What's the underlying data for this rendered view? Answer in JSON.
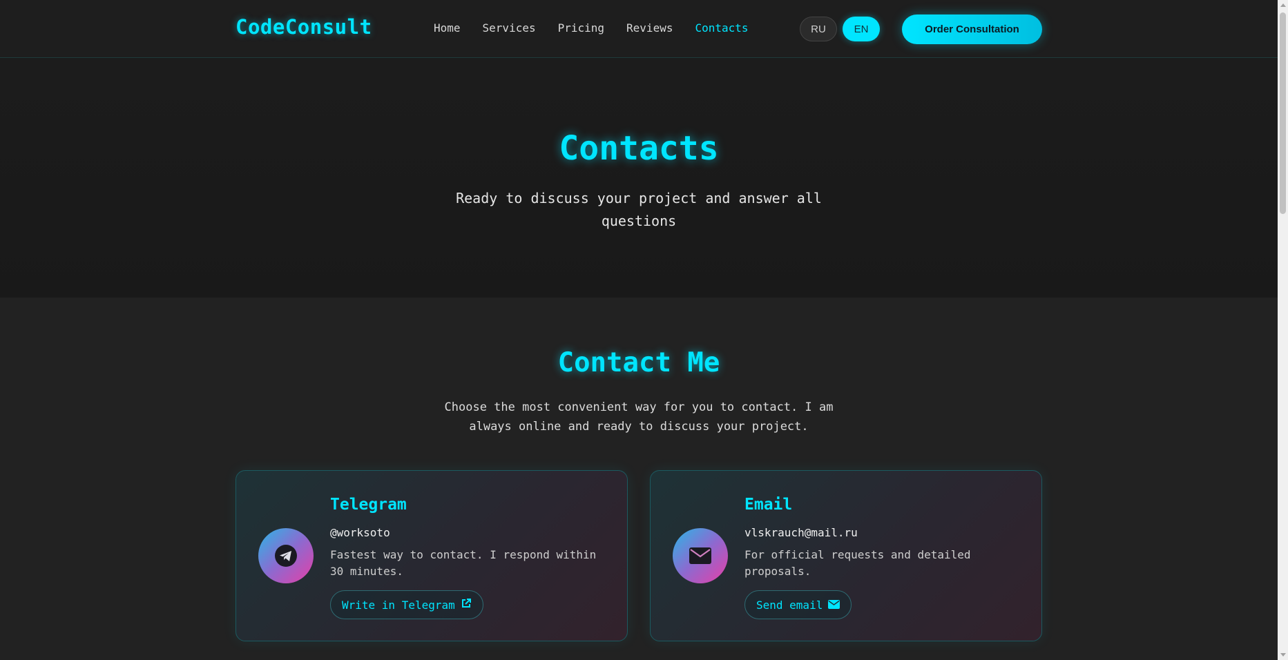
{
  "header": {
    "logo": "CodeConsult",
    "nav": [
      {
        "label": "Home",
        "active": false
      },
      {
        "label": "Services",
        "active": false
      },
      {
        "label": "Pricing",
        "active": false
      },
      {
        "label": "Reviews",
        "active": false
      },
      {
        "label": "Contacts",
        "active": true
      }
    ],
    "lang_ru": "RU",
    "lang_en": "EN",
    "order_button": "Order Consultation"
  },
  "hero": {
    "title": "Contacts",
    "subtitle": "Ready to discuss your project and answer all questions"
  },
  "contact": {
    "title": "Contact Me",
    "subtitle": "Choose the most convenient way for you to contact. I am always online and ready to discuss your project.",
    "cards": [
      {
        "title": "Telegram",
        "handle": "@worksoto",
        "description": "Fastest way to contact. I respond within 30 minutes.",
        "button": "Write in Telegram",
        "icon": "telegram-icon",
        "button_icon": "external-link-icon"
      },
      {
        "title": "Email",
        "handle": "vlskrauch@mail.ru",
        "description": "For official requests and detailed proposals.",
        "button": "Send email",
        "icon": "envelope-icon",
        "button_icon": "envelope-icon"
      }
    ]
  },
  "colors": {
    "accent": "#00e5ff",
    "background": "#1a1a1a",
    "gradient_start": "#2ab7e6",
    "gradient_end": "#e63fa6"
  }
}
